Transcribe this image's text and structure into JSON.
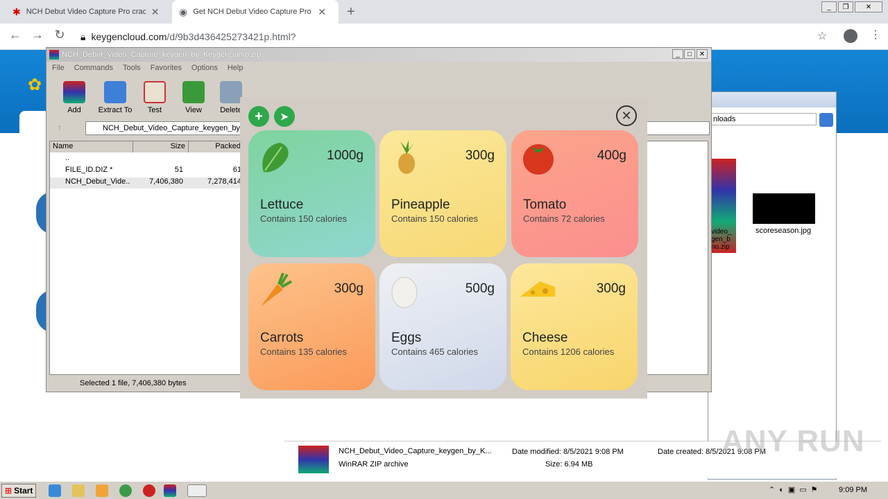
{
  "browser": {
    "tabs": [
      {
        "title": "NCH Debut Video Capture Pro crack"
      },
      {
        "title": "Get NCH Debut Video Capture Pro ke"
      }
    ],
    "url_domain": "keygencloud.com",
    "url_path": "/d/9b3d436425273421p.html?"
  },
  "winrar": {
    "title": "NCH_Debut_Video_Capture_keygen_by_KeygenSumo.zip",
    "menu": [
      "File",
      "Commands",
      "Tools",
      "Favorites",
      "Options",
      "Help"
    ],
    "tools": [
      "Add",
      "Extract To",
      "Test",
      "View",
      "Delete"
    ],
    "path": "NCH_Debut_Video_Capture_keygen_by_",
    "columns": [
      "Name",
      "Size",
      "Packed"
    ],
    "rows": [
      {
        "name": "..",
        "size": "",
        "packed": ""
      },
      {
        "name": "FILE_ID.DIZ *",
        "size": "51",
        "packed": "61"
      },
      {
        "name": "NCH_Debut_Vide...",
        "size": "7,406,380",
        "packed": "7,278,414"
      }
    ],
    "status": "Selected 1 file, 7,406,380 bytes"
  },
  "explorer": {
    "search_text": "nloads",
    "file_label": "scoreseason.jpg",
    "zip_label": "video_\ngen_b\nno.zip",
    "footer_name": "NCH_Debut_Video_Capture_keygen_by_K...",
    "footer_type": "WinRAR ZIP archive",
    "date_modified": "Date modified: 8/5/2021 9:08 PM",
    "size": "Size: 6.94 MB",
    "date_created": "Date created: 8/5/2021 9:08 PM"
  },
  "food": {
    "items": [
      {
        "name": "Lettuce",
        "weight": "1000g",
        "calories": "Contains 150 calories",
        "icon": "lettuce-icon",
        "gradient": [
          "#7fd49e",
          "#8fd6cf"
        ]
      },
      {
        "name": "Pineapple",
        "weight": "300g",
        "calories": "Contains 150 calories",
        "icon": "pineapple-icon",
        "gradient": [
          "#fbe89a",
          "#f7d874"
        ]
      },
      {
        "name": "Tomato",
        "weight": "400g",
        "calories": "Contains 72 calories",
        "icon": "tomato-icon",
        "gradient": [
          "#fca48a",
          "#fb8f8f"
        ]
      },
      {
        "name": "Carrots",
        "weight": "300g",
        "calories": "Contains 135 calories",
        "icon": "carrot-icon",
        "gradient": [
          "#fdc38b",
          "#fb9a5a"
        ]
      },
      {
        "name": "Eggs",
        "weight": "500g",
        "calories": "Contains 465 calories",
        "icon": "egg-icon",
        "gradient": [
          "#eef0f4",
          "#cfd8ea"
        ]
      },
      {
        "name": "Cheese",
        "weight": "300g",
        "calories": "Contains 1206 calories",
        "icon": "cheese-icon",
        "gradient": [
          "#fde79a",
          "#f8d56c"
        ]
      }
    ]
  },
  "taskbar": {
    "start": "Start",
    "clock": "9:09 PM"
  },
  "watermark": "ANY RUN"
}
